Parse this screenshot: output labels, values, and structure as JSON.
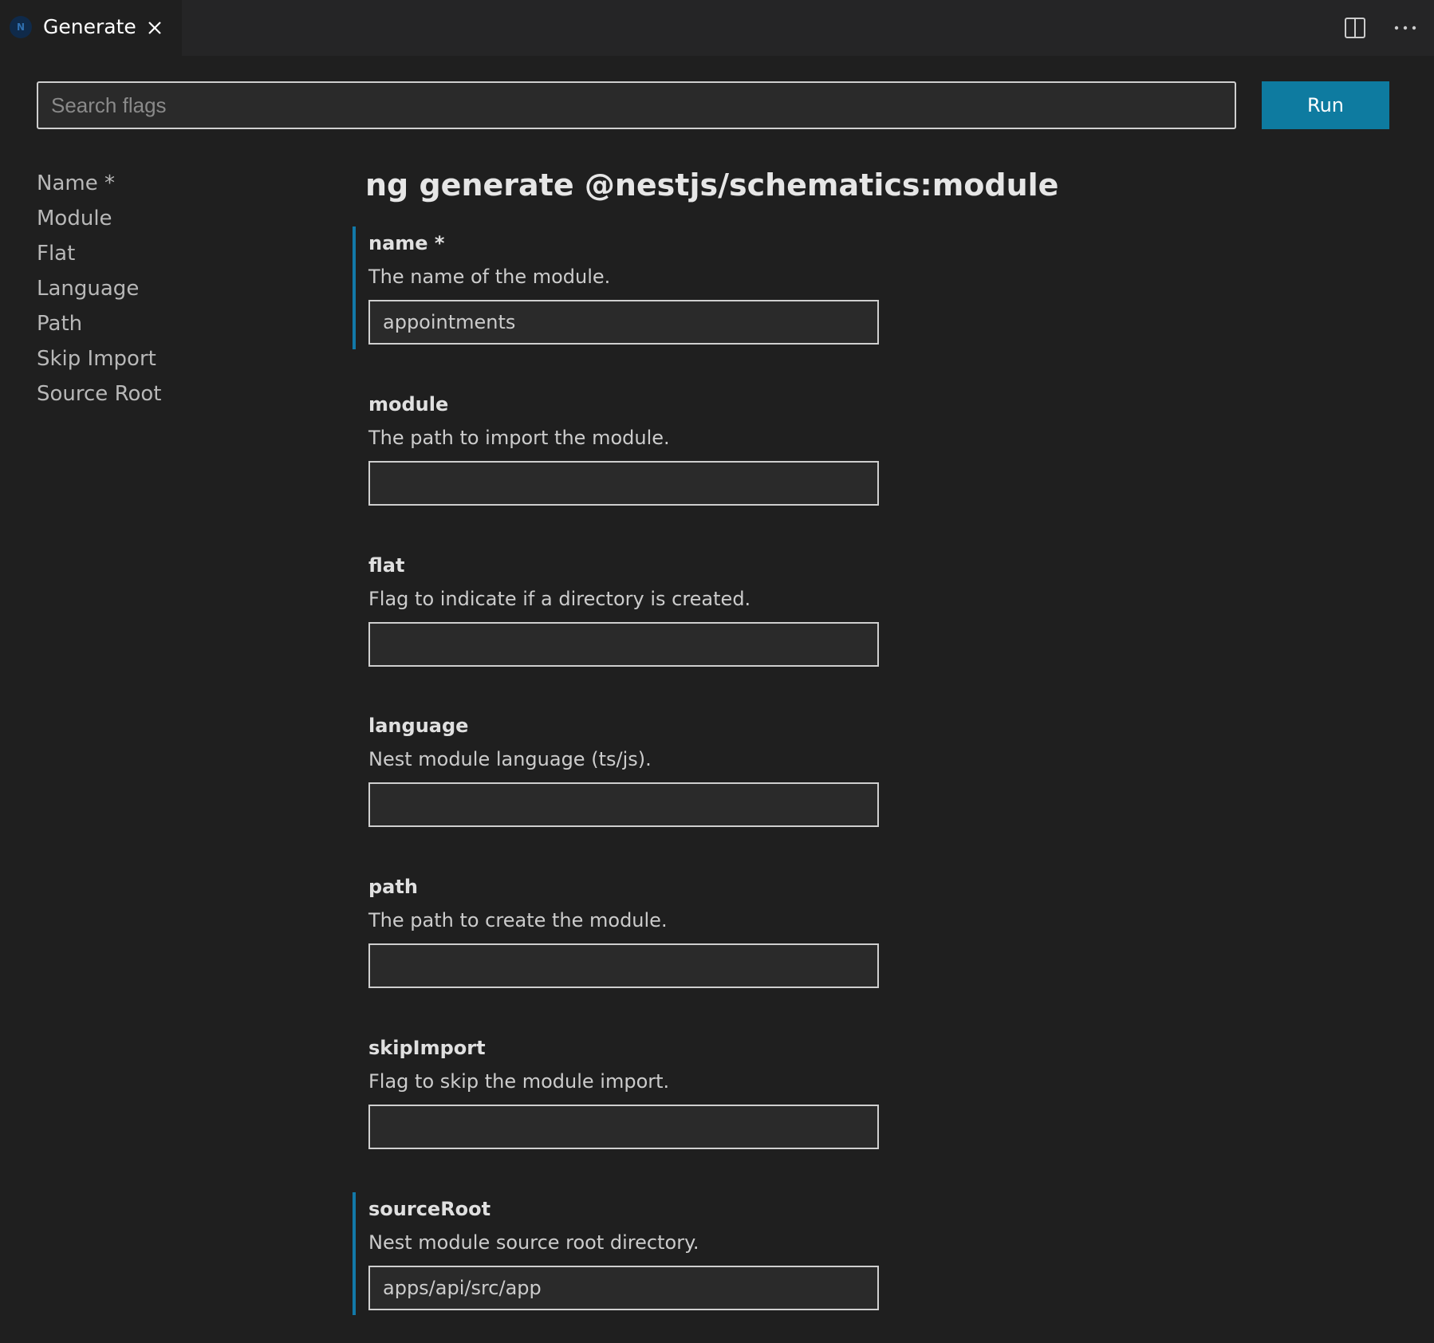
{
  "tab": {
    "title": "Generate",
    "logo_text": "N"
  },
  "icons": {
    "logo": "nestjs-logo-icon",
    "close": "close-icon",
    "split_editor": "split-editor-icon",
    "more_actions": "more-actions-icon"
  },
  "colors": {
    "accent": "#0e7ba0",
    "highlight_border": "#1279a8",
    "background": "#1f1f1f"
  },
  "search": {
    "placeholder": "Search flags",
    "value": ""
  },
  "run_label": "Run",
  "title": "ng generate @nestjs/schematics:module",
  "nav": [
    "Name *",
    "Module",
    "Flat",
    "Language",
    "Path",
    "Skip Import",
    "Source Root"
  ],
  "flags": [
    {
      "name": "name *",
      "description": "The name of the module.",
      "value": "appointments",
      "highlighted": true
    },
    {
      "name": "module",
      "description": "The path to import the module.",
      "value": "",
      "highlighted": false
    },
    {
      "name": "flat",
      "description": "Flag to indicate if a directory is created.",
      "value": "",
      "highlighted": false
    },
    {
      "name": "language",
      "description": "Nest module language (ts/js).",
      "value": "",
      "highlighted": false
    },
    {
      "name": "path",
      "description": "The path to create the module.",
      "value": "",
      "highlighted": false
    },
    {
      "name": "skipImport",
      "description": "Flag to skip the module import.",
      "value": "",
      "highlighted": false
    },
    {
      "name": "sourceRoot",
      "description": "Nest module source root directory.",
      "value": "apps/api/src/app",
      "highlighted": true
    }
  ]
}
